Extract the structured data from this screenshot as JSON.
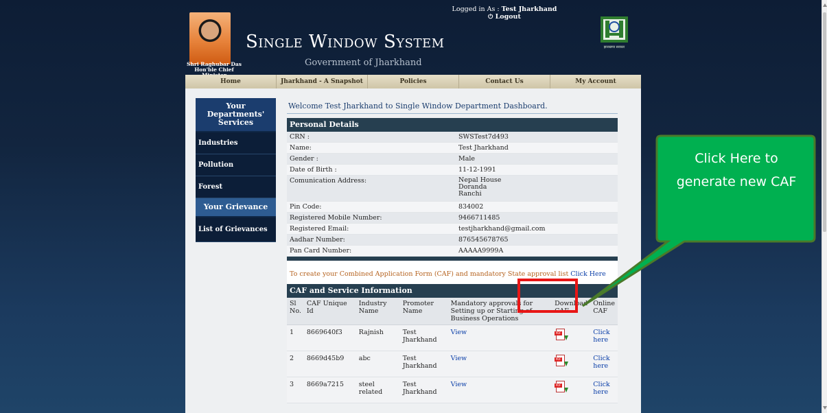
{
  "header": {
    "cm_name": "Shri Raghubar Das",
    "cm_title": "Hon'ble Chief Minister",
    "site_title": "Single Window System",
    "site_subtitle": "Government of Jharkhand",
    "logged_in_label": "Logged in As : ",
    "logged_in_user": "Test Jharkhand",
    "logout_label": "Logout",
    "logo_caption": "झारखण्ड सरकार"
  },
  "nav": {
    "items": [
      {
        "label": "Home"
      },
      {
        "label": "Jharkhand - A Snapshot"
      },
      {
        "label": "Policies"
      },
      {
        "label": "Contact Us"
      },
      {
        "label": "My Account"
      }
    ]
  },
  "sidebar": {
    "dept_header": "Your Departments' Services",
    "items": [
      "Industries",
      "Pollution",
      "Forest"
    ],
    "grievance_header": "Your Grievance",
    "grievance_items": [
      "List of Grievances"
    ]
  },
  "content": {
    "welcome": "Welcome Test Jharkhand to Single Window Department Dashboard.",
    "personal_header": "Personal Details",
    "personal": [
      {
        "label": "CRN :",
        "value": "SWSTest7d493"
      },
      {
        "label": "Name:",
        "value": "Test Jharkhand"
      },
      {
        "label": "Gender :",
        "value": "Male"
      },
      {
        "label": "Date of Birth :",
        "value": "11-12-1991"
      },
      {
        "label": "Comunication Address:",
        "value_lines": [
          "Nepal House",
          "Doranda",
          "Ranchi"
        ]
      },
      {
        "label": "Pin Code:",
        "value": "834002"
      },
      {
        "label": "Registered Mobile Number:",
        "value": "9466711485"
      },
      {
        "label": "Registered Email:",
        "value": "testjharkhand@gmail.com"
      },
      {
        "label": "Aadhar Number:",
        "value": "876545678765"
      },
      {
        "label": "Pan Card Number:",
        "value": "AAAAA9999A"
      }
    ],
    "caf_note": "To create your Combined Application Form (CAF) and mandatory State approval list ",
    "caf_link": "Click Here",
    "caf_header": "CAF and Service Information",
    "caf_columns": [
      "Sl No.",
      "CAF Unique Id",
      "Industry Name",
      "Promoter Name",
      "Mandatory approvals for Setting up or Starting of Business Operations",
      "Download CAF",
      "Online CAF"
    ],
    "caf_rows": [
      {
        "sl": "1",
        "id": "8669640f3",
        "industry": "Rajnish",
        "promoter": "Test Jharkhand",
        "approvals": "View",
        "online": "Click here"
      },
      {
        "sl": "2",
        "id": "8669d45b9",
        "industry": "abc",
        "promoter": "Test Jharkhand",
        "approvals": "View",
        "online": "Click here"
      },
      {
        "sl": "3",
        "id": "8669a7215",
        "industry": "steel related",
        "promoter": "Test Jharkhand",
        "approvals": "View",
        "online": "Click here"
      }
    ]
  },
  "callout": {
    "text": "Click Here to generate new CAF"
  },
  "colors": {
    "callout_fill": "#00b050",
    "highlight": "#e81616",
    "sidebar": "#0c1e38"
  }
}
